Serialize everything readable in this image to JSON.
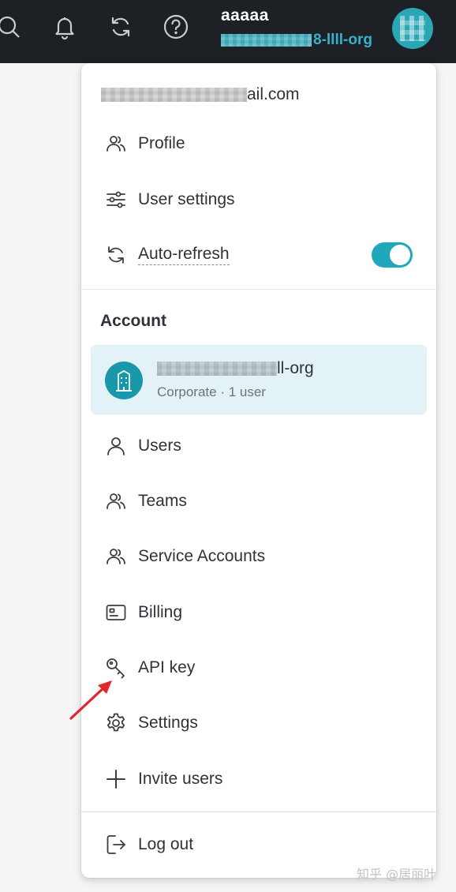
{
  "topbar": {
    "icons": [
      "search-icon",
      "bell-icon",
      "refresh-icon",
      "help-icon"
    ],
    "user_name": "aaaaa",
    "org_visible_suffix": "8-llll-org",
    "colors": {
      "background": "#1d2025",
      "org_link": "#36b3c8",
      "avatar": "#2aa6b4"
    }
  },
  "menu": {
    "email_visible_suffix": "ail.com",
    "items_top": [
      {
        "label": "Profile",
        "icon": "users-icon"
      },
      {
        "label": "User settings",
        "icon": "sliders-icon"
      },
      {
        "label": "Auto-refresh",
        "icon": "refresh-icon",
        "toggle_on": true
      }
    ],
    "account": {
      "title": "Account",
      "org": {
        "visible_suffix": "ll-org",
        "subtitle": "Corporate · 1 user",
        "icon": "building-icon"
      },
      "items": [
        {
          "label": "Users",
          "icon": "user-icon"
        },
        {
          "label": "Teams",
          "icon": "users-icon"
        },
        {
          "label": "Service Accounts",
          "icon": "users-icon"
        },
        {
          "label": "Billing",
          "icon": "card-icon"
        },
        {
          "label": "API key",
          "icon": "key-icon"
        },
        {
          "label": "Settings",
          "icon": "gear-icon"
        },
        {
          "label": "Invite users",
          "icon": "plus-icon"
        }
      ]
    },
    "logout": {
      "label": "Log out",
      "icon": "logout-icon"
    },
    "colors": {
      "toggle": "#1fa8bb",
      "org_card_bg": "#e3f2f6",
      "org_avatar": "#1898aa",
      "arrow": "#e0262e"
    }
  },
  "watermark": "知乎 @居丽叶"
}
